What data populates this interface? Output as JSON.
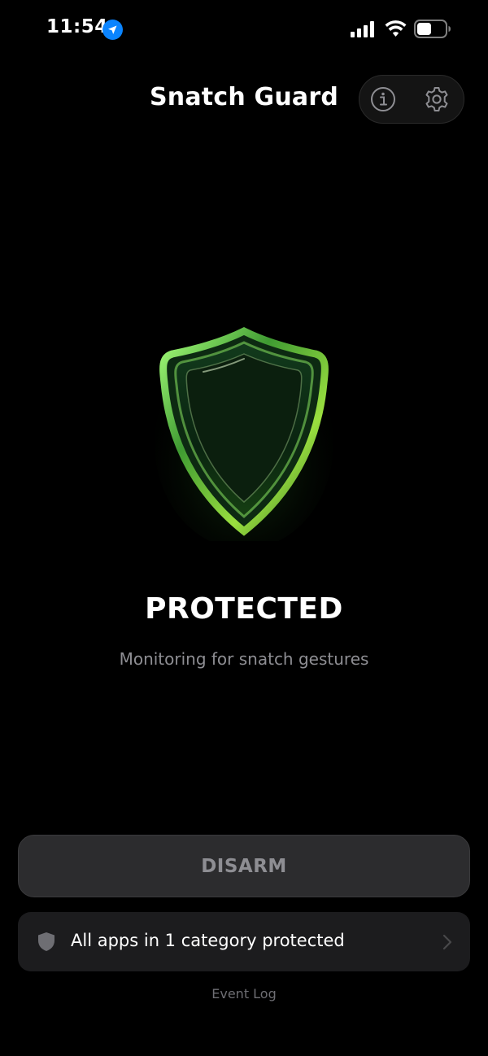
{
  "status_bar": {
    "time": "11:54",
    "icons": [
      "location-icon",
      "signal-icon",
      "wifi-icon",
      "battery-icon"
    ]
  },
  "header": {
    "title": "Snatch Guard",
    "actions": [
      "info-icon",
      "gear-icon"
    ]
  },
  "status": {
    "state": "PROTECTED",
    "subtitle": "Monitoring for snatch gestures"
  },
  "controls": {
    "disarm_label": "DISARM",
    "protection_summary": "All apps in 1 category protected",
    "event_log_label": "Event Log"
  },
  "colors": {
    "background": "#000000",
    "accent_green": "#7ed957",
    "location_blue": "#0a84ff",
    "button_bg": "#2c2c2e",
    "muted_text": "#8e8e93"
  }
}
